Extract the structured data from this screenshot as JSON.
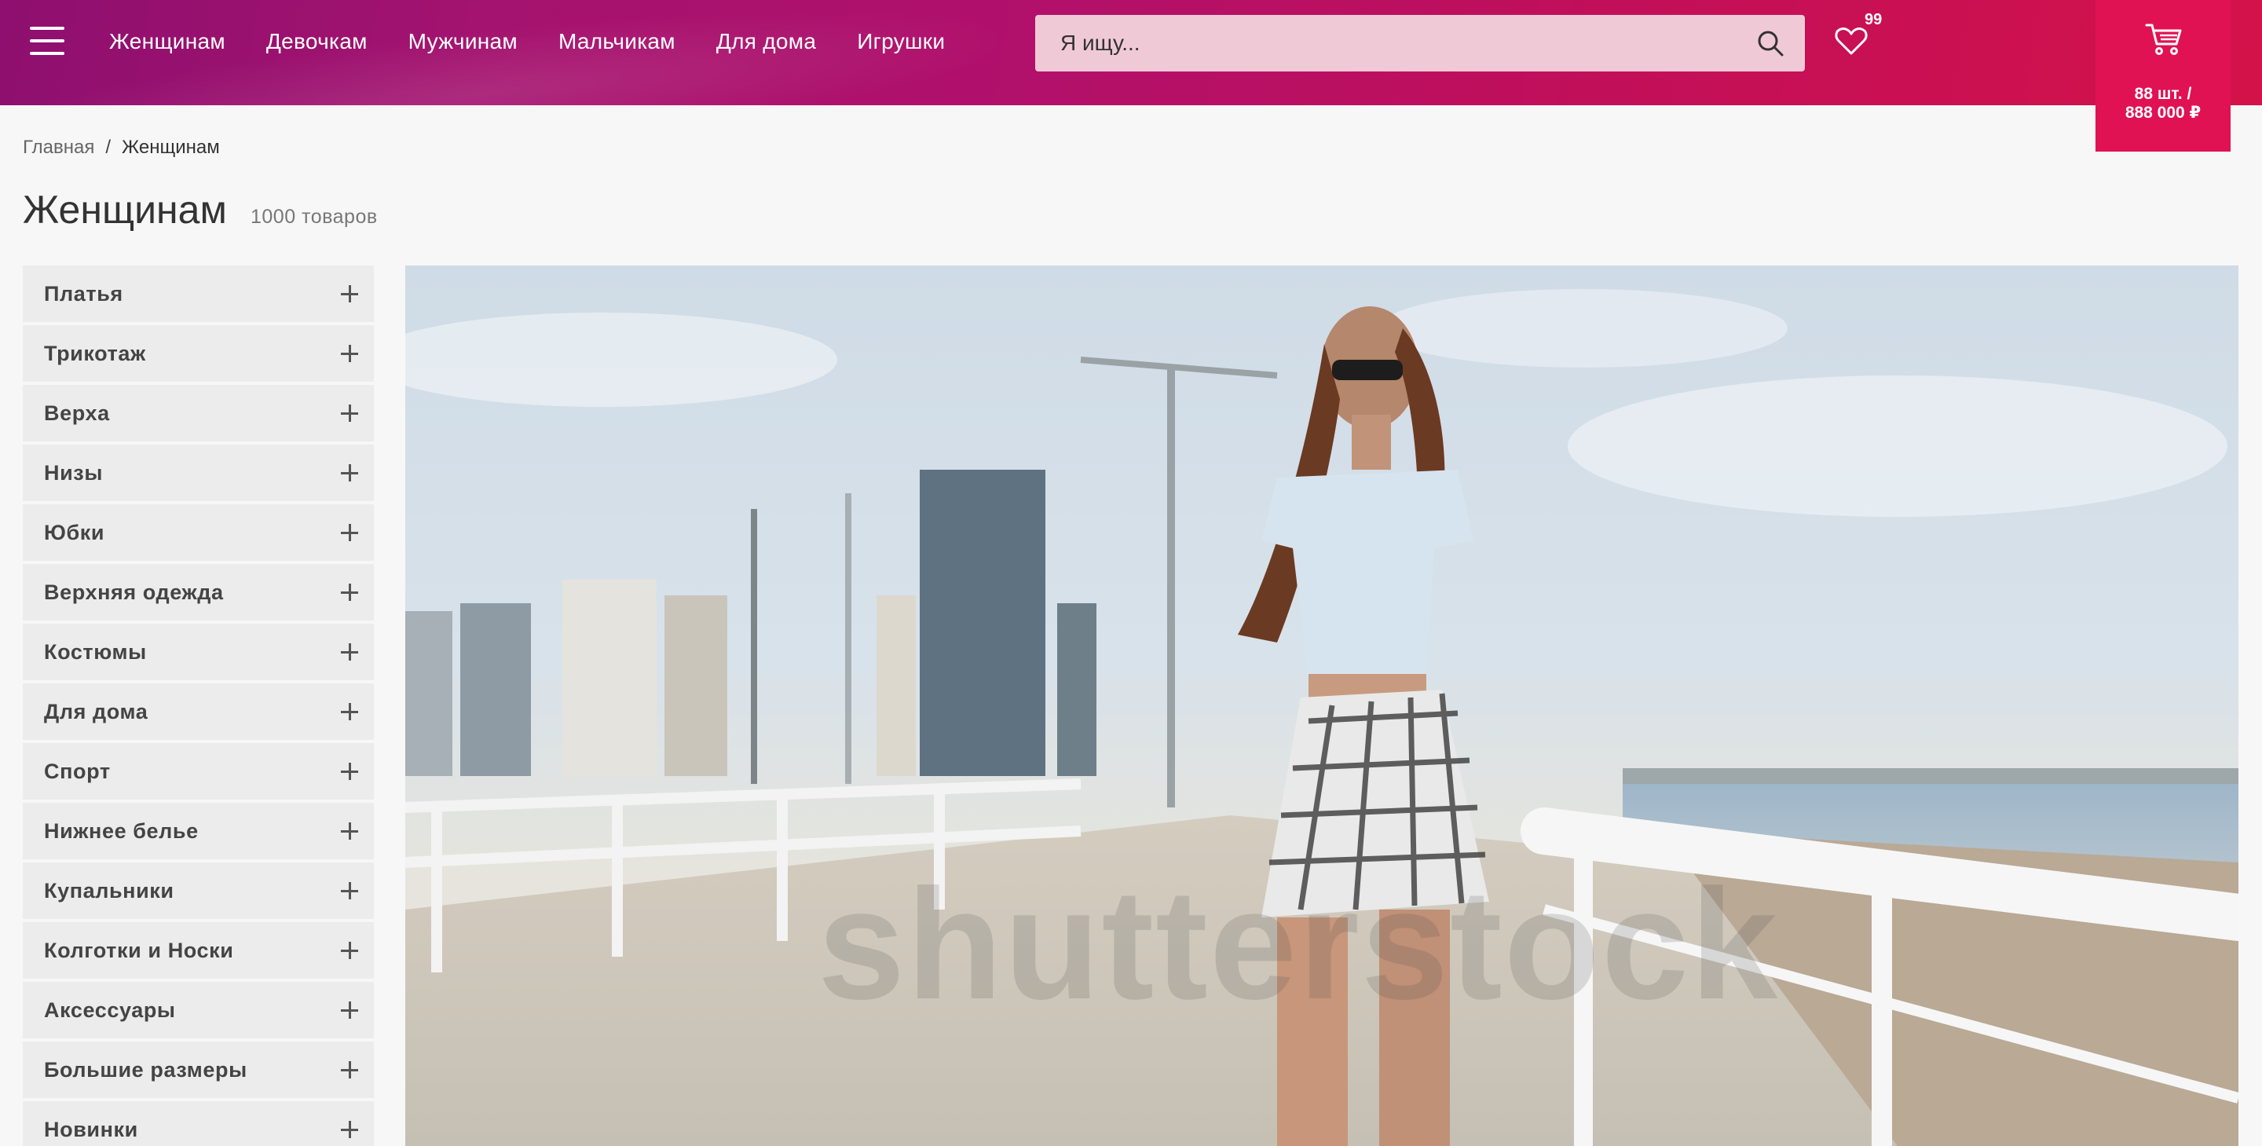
{
  "header": {
    "menu_icon": "hamburger-menu-icon",
    "nav": [
      {
        "label": "Женщинам"
      },
      {
        "label": "Девочкам"
      },
      {
        "label": "Мужчинам"
      },
      {
        "label": "Мальчикам"
      },
      {
        "label": "Для дома"
      },
      {
        "label": "Игрушки"
      }
    ],
    "search": {
      "placeholder": "Я ищу...",
      "icon": "search-icon"
    },
    "favorites": {
      "icon": "heart-icon",
      "count": "99"
    },
    "cart": {
      "icon": "cart-icon",
      "line1": "88 шт. /",
      "line2": "888 000 ₽"
    }
  },
  "breadcrumb": {
    "home": "Главная",
    "separator": "/",
    "current": "Женщинам"
  },
  "page": {
    "title": "Женщинам",
    "count": "1000 товаров"
  },
  "sidebar": {
    "categories": [
      {
        "label": "Платья"
      },
      {
        "label": "Трикотаж"
      },
      {
        "label": "Верха"
      },
      {
        "label": "Низы"
      },
      {
        "label": "Юбки"
      },
      {
        "label": "Верхняя одежда"
      },
      {
        "label": "Костюмы"
      },
      {
        "label": "Для дома"
      },
      {
        "label": "Спорт"
      },
      {
        "label": "Нижнее белье"
      },
      {
        "label": "Купальники"
      },
      {
        "label": "Колготки и Носки"
      },
      {
        "label": "Аксессуары"
      },
      {
        "label": "Большие размеры"
      },
      {
        "label": "Новинки"
      }
    ]
  },
  "banner": {
    "watermark": "shutterstock"
  },
  "colors": {
    "header_start": "#8e0f6f",
    "header_end": "#d4124a",
    "cart_bg": "#e01253",
    "search_bg": "#f0c9d7"
  }
}
